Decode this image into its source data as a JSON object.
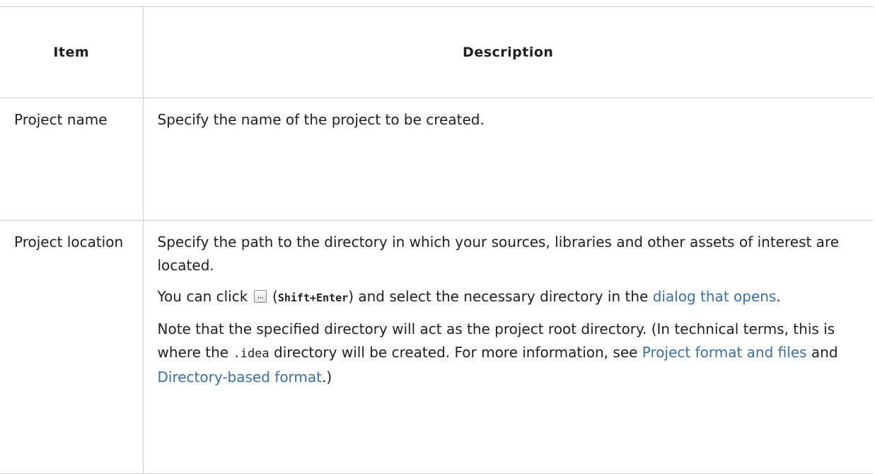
{
  "table": {
    "headers": {
      "item": "Item",
      "description": "Description"
    },
    "rows": [
      {
        "item": "Project name",
        "description": "Specify the name of the project to be created."
      },
      {
        "item": "Project location",
        "p1": "Specify the path to the directory in which your sources, libraries and other assets of interest are located.",
        "p2_before": "You can click ",
        "p2_button_icon": "browse-ellipsis-icon",
        "p2_paren_open": " (",
        "p2_shortcut": "Shift+Enter",
        "p2_mid": ") and select the necessary directory in the ",
        "p2_link": "dialog that opens",
        "p2_end": ".",
        "p3_before": "Note that the specified directory will act as the project root directory. (In technical terms, this is where the ",
        "p3_code": ".idea",
        "p3_mid": " directory will be created. For more information, see ",
        "p3_link1": "Project format and files",
        "p3_and": " and ",
        "p3_link2": "Directory-based format",
        "p3_end": ".)"
      }
    ]
  },
  "colors": {
    "link": "#3c6ea3",
    "border": "#cfcfcf",
    "text": "#1f1f1f"
  }
}
